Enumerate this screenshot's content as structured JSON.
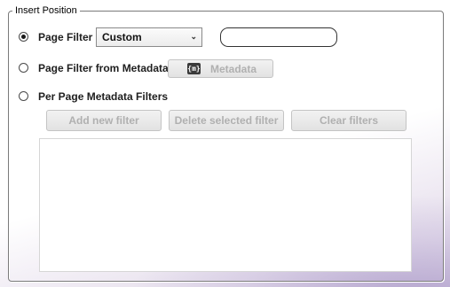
{
  "group": {
    "title": "Insert Position"
  },
  "page_filter": {
    "label": "Page Filter",
    "selected": true,
    "dropdown_value": "Custom",
    "text_value": ""
  },
  "metadata_filter": {
    "label": "Page Filter from Metadata",
    "selected": false,
    "button_label": "Metadata",
    "icon_text": "{m}",
    "button_enabled": false
  },
  "per_page_filter": {
    "label": "Per Page Metadata Filters",
    "selected": false
  },
  "filter_buttons": {
    "add": "Add new filter",
    "delete": "Delete selected filter",
    "clear": "Clear filters",
    "enabled": false
  },
  "filters_list": {
    "items": []
  }
}
